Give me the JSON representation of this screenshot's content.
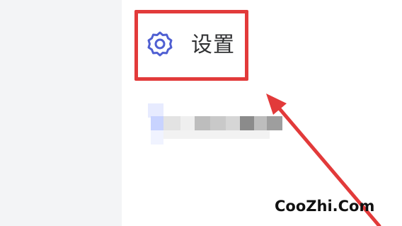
{
  "settings": {
    "label": "设置",
    "icon": "gear-icon"
  },
  "watermark": {
    "text": "CooZhi.Com"
  },
  "colors": {
    "highlight": "#e23a3a",
    "icon": "#4f5fd2",
    "text": "#303133",
    "sidebar": "#f3f4f6"
  }
}
